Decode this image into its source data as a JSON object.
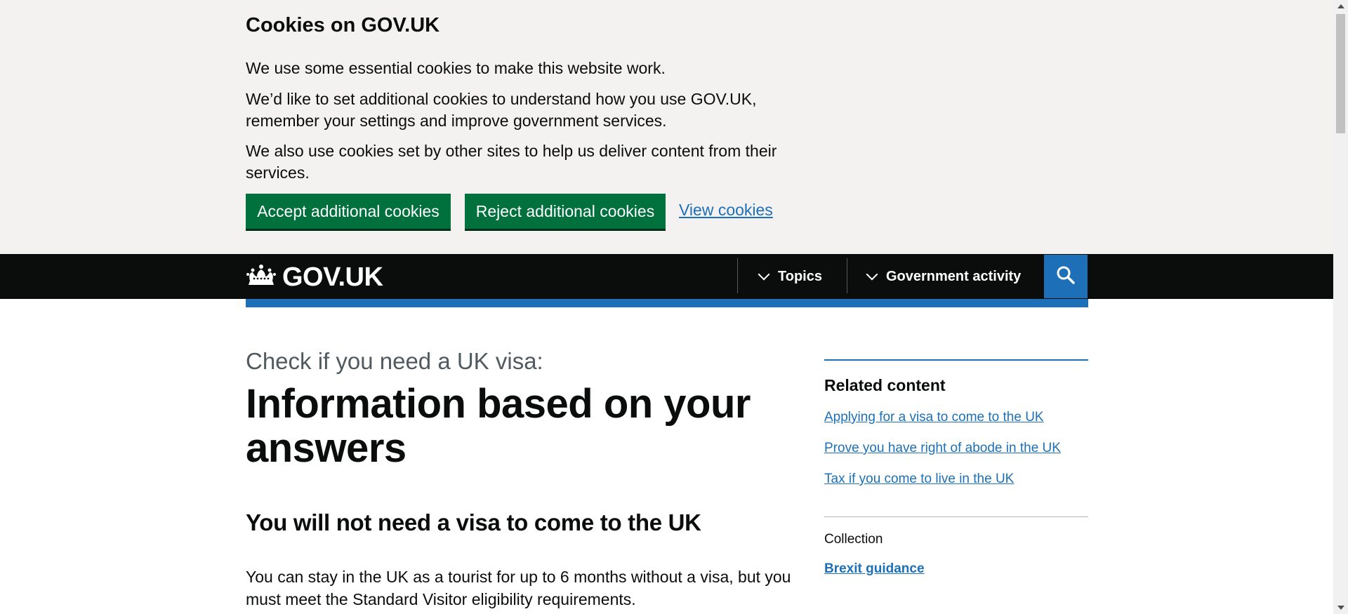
{
  "cookie_banner": {
    "title": "Cookies on GOV.UK",
    "p1": "We use some essential cookies to make this website work.",
    "p2": "We’d like to set additional cookies to understand how you use GOV.UK, remember your settings and improve government services.",
    "p3": "We also use cookies set by other sites to help us deliver content from their services.",
    "accept_label": "Accept additional cookies",
    "reject_label": "Reject additional cookies",
    "view_label": "View cookies"
  },
  "header": {
    "logo_text": "GOV.UK",
    "nav": [
      {
        "label": "Topics",
        "icon": "chevron-down-icon"
      },
      {
        "label": "Government activity",
        "icon": "chevron-down-icon"
      }
    ],
    "search_icon": "search-icon"
  },
  "main": {
    "caption": "Check if you need a UK visa:",
    "title": "Information based on your answers",
    "heading": "You will not need a visa to come to the UK",
    "body": "You can stay in the UK as a tourist for up to 6 months without a visa, but you must meet the Standard Visitor eligibility requirements."
  },
  "sidebar": {
    "related_heading": "Related content",
    "links": [
      "Applying for a visa to come to the UK",
      "Prove you have right of abode in the UK",
      "Tax if you come to live in the UK"
    ],
    "collection_label": "Collection",
    "collection_link": "Brexit guidance"
  },
  "colors": {
    "brand_blue": "#1d70b8",
    "button_green": "#00703c",
    "header_black": "#0b0c0c",
    "banner_grey": "#f3f2f1"
  }
}
